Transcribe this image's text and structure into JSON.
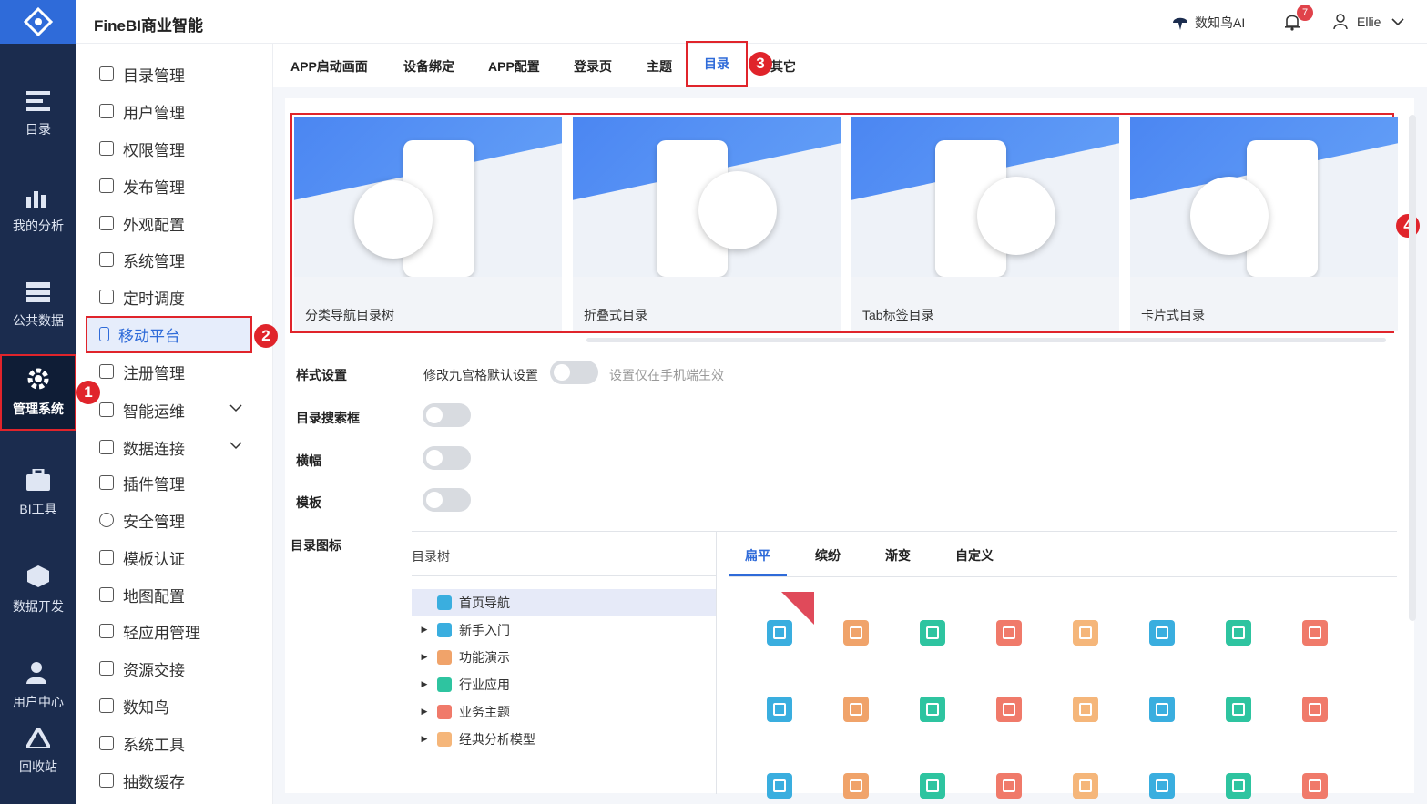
{
  "app": {
    "brand": "FineBI商业智能",
    "ai_label": "数知鸟AI",
    "notifications": "7",
    "user": "Ellie"
  },
  "rail": [
    {
      "label": "目录",
      "icon": "catalog-icon"
    },
    {
      "label": "我的分析",
      "icon": "analysis-icon"
    },
    {
      "label": "公共数据",
      "icon": "database-icon"
    },
    {
      "label": "管理系统",
      "icon": "gear-icon"
    },
    {
      "label": "BI工具",
      "icon": "toolbox-icon"
    },
    {
      "label": "数据开发",
      "icon": "cube-icon"
    },
    {
      "label": "用户中心",
      "icon": "user-icon"
    },
    {
      "label": "回收站",
      "icon": "recycle-icon"
    }
  ],
  "sidebar": [
    {
      "label": "目录管理"
    },
    {
      "label": "用户管理"
    },
    {
      "label": "权限管理"
    },
    {
      "label": "发布管理"
    },
    {
      "label": "外观配置"
    },
    {
      "label": "系统管理"
    },
    {
      "label": "定时调度"
    },
    {
      "label": "移动平台"
    },
    {
      "label": "注册管理"
    },
    {
      "label": "智能运维"
    },
    {
      "label": "数据连接"
    },
    {
      "label": "插件管理"
    },
    {
      "label": "安全管理"
    },
    {
      "label": "模板认证"
    },
    {
      "label": "地图配置"
    },
    {
      "label": "轻应用管理"
    },
    {
      "label": "资源交接"
    },
    {
      "label": "数知鸟"
    },
    {
      "label": "系统工具"
    },
    {
      "label": "抽数缓存"
    }
  ],
  "tabs": [
    "APP启动画面",
    "设备绑定",
    "APP配置",
    "登录页",
    "主题",
    "目录",
    "其它"
  ],
  "cards": [
    "分类导航目录树",
    "折叠式目录",
    "Tab标签目录",
    "卡片式目录"
  ],
  "settings": {
    "style_label": "样式设置",
    "toggle_label": "修改九宫格默认设置",
    "hint": "设置仅在手机端生效",
    "search_label": "目录搜索框",
    "banner_label": "横幅",
    "template_label": "模板",
    "icon_label": "目录图标"
  },
  "tree": {
    "header": "目录树",
    "nodes": [
      {
        "label": "首页导航",
        "color": "#3aaedf"
      },
      {
        "label": "新手入门",
        "color": "#3aaedf"
      },
      {
        "label": "功能演示",
        "color": "#f0a36a"
      },
      {
        "label": "行业应用",
        "color": "#2ec4a0"
      },
      {
        "label": "业务主题",
        "color": "#f07a6a"
      },
      {
        "label": "经典分析模型",
        "color": "#f5b67a"
      }
    ]
  },
  "style_tabs": [
    "扁平",
    "缤纷",
    "渐变",
    "自定义"
  ],
  "icon_colors": [
    "#3aaedf",
    "#f0a36a",
    "#2ec4a0",
    "#f07a6a",
    "#f5b67a",
    "#3aaedf",
    "#2ec4a0",
    "#f07a6a"
  ],
  "markers": [
    "1",
    "2",
    "3",
    "4"
  ]
}
